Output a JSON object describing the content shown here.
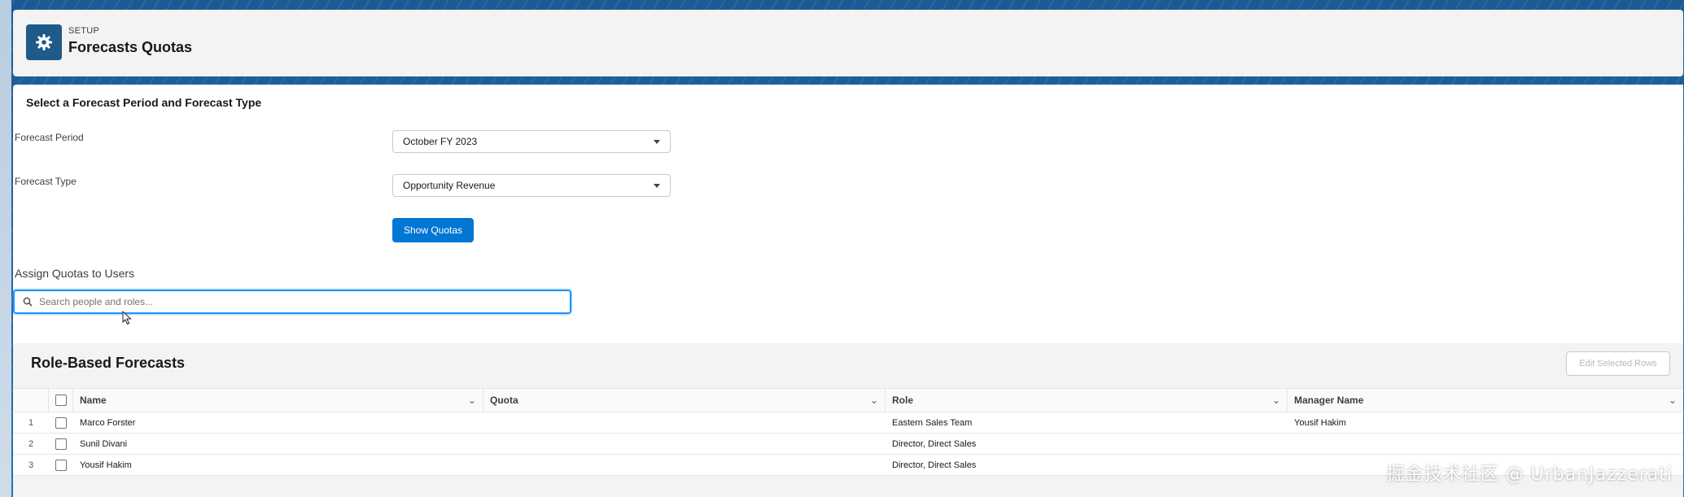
{
  "header": {
    "eyebrow": "SETUP",
    "title": "Forecasts Quotas",
    "icon": "gear-icon"
  },
  "selection": {
    "section_title": "Select a Forecast Period and Forecast Type",
    "period_label": "Forecast Period",
    "period_value": "October FY 2023",
    "type_label": "Forecast Type",
    "type_value": "Opportunity Revenue",
    "show_button": "Show Quotas"
  },
  "assign": {
    "label": "Assign Quotas to Users",
    "search_placeholder": "Search people and roles...",
    "search_value": ""
  },
  "grid": {
    "title": "Role-Based Forecasts",
    "edit_button": "Edit Selected Rows",
    "columns": [
      "Name",
      "Quota",
      "Role",
      "Manager Name"
    ],
    "rows": [
      {
        "num": "1",
        "name": "Marco Forster",
        "quota": "",
        "role": "Eastern Sales Team",
        "manager": "Yousif Hakim"
      },
      {
        "num": "2",
        "name": "Sunil Divani",
        "quota": "",
        "role": "Director, Direct Sales",
        "manager": ""
      },
      {
        "num": "3",
        "name": "Yousif Hakim",
        "quota": "",
        "role": "Director, Direct Sales",
        "manager": ""
      }
    ]
  },
  "watermark": "掘金技术社区 @ UrbanJazzerati",
  "colors": {
    "brand": "#0176d3",
    "header_icon_bg": "#1e5a8a",
    "focus_border": "#1b96ff"
  }
}
